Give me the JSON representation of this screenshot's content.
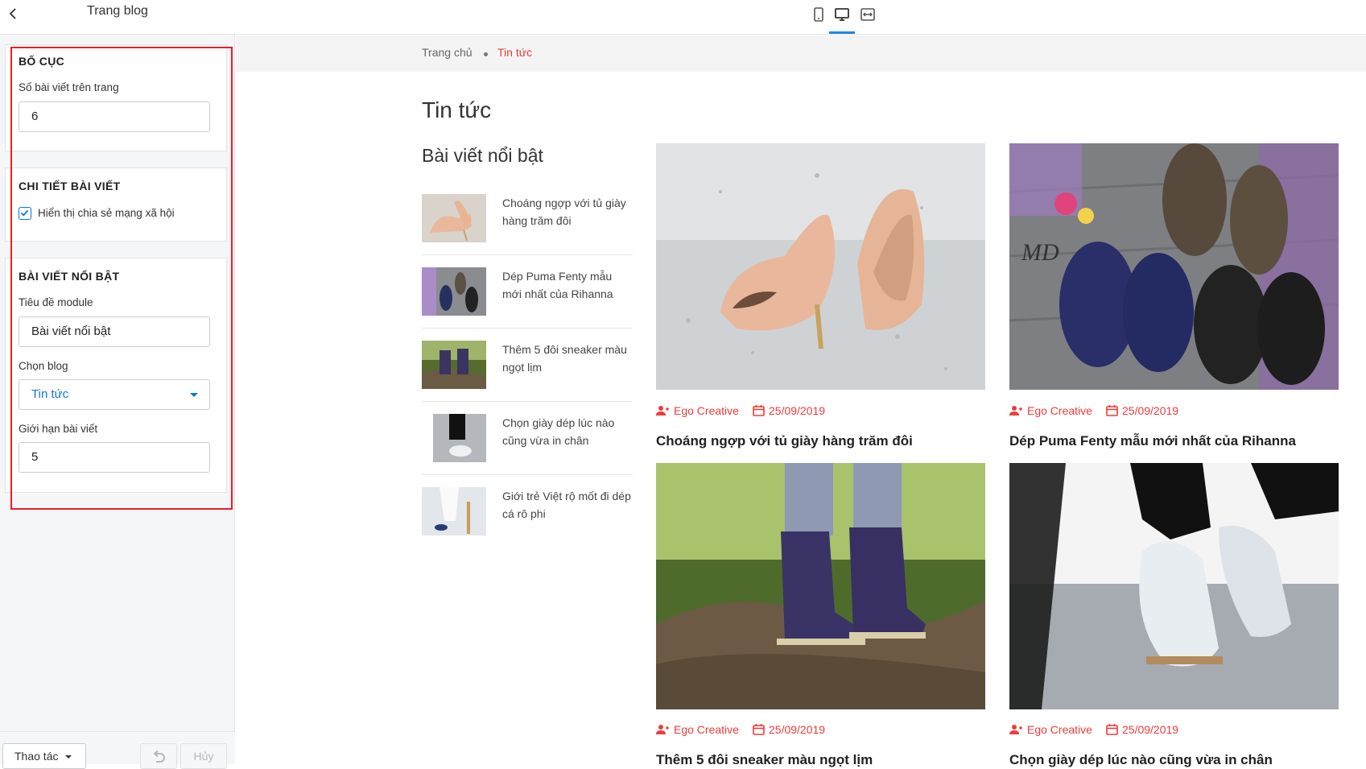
{
  "sidebar": {
    "title": "Trang blog",
    "layout": {
      "title": "BỐ CỤC",
      "posts_per_page_label": "Số bài viết trên trang",
      "posts_per_page_value": "6"
    },
    "post_detail": {
      "title": "CHI TIẾT BÀI VIẾT",
      "share_label": "Hiển thị chia sẻ mạng xã hội",
      "share_checked": true
    },
    "featured": {
      "title": "BÀI VIẾT NỔI BẬT",
      "module_title_label": "Tiêu đề module",
      "module_title_value": "Bài viết nổi bật",
      "blog_label": "Chọn blog",
      "blog_value": "Tin tức",
      "limit_label": "Giới hạn bài viết",
      "limit_value": "5"
    },
    "footer": {
      "actions_label": "Thao tác",
      "cancel_label": "Hủy"
    }
  },
  "preview": {
    "breadcrumb": {
      "home": "Trang chủ",
      "current": "Tin tức"
    },
    "page_title": "Tin tức",
    "featured_title": "Bài viết nổi bật",
    "featured_items": [
      {
        "title": "Choáng ngợp với tủ giày hàng trăm đôi"
      },
      {
        "title": "Dép Puma Fenty mẫu mới nhất của Rihanna"
      },
      {
        "title": "Thêm 5 đôi sneaker màu ngọt lịm"
      },
      {
        "title": "Chọn giày dép lúc nào cũng vừa in chân"
      },
      {
        "title": "Giới trẻ Việt rộ mốt đi dép cá rô phi"
      }
    ],
    "posts": [
      {
        "author": "Ego Creative",
        "date": "25/09/2019",
        "title": "Choáng ngợp với tủ giày hàng trăm đôi"
      },
      {
        "author": "Ego Creative",
        "date": "25/09/2019",
        "title": "Dép Puma Fenty mẫu mới nhất của Rihanna"
      },
      {
        "author": "Ego Creative",
        "date": "25/09/2019",
        "title": "Thêm 5 đôi sneaker màu ngọt lịm"
      },
      {
        "author": "Ego Creative",
        "date": "25/09/2019",
        "title": "Chọn giày dép lúc nào cũng vừa in chân"
      }
    ]
  },
  "colors": {
    "accent": "#ee3b3b",
    "link": "#0c76d6",
    "highlight_border": "#ee1c25",
    "device_active": "#1e88e5"
  }
}
